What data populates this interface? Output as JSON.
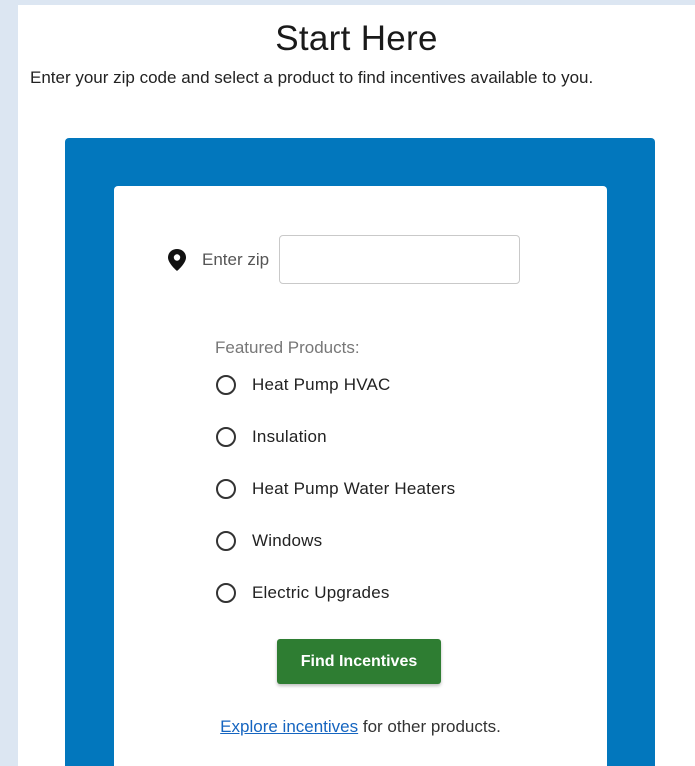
{
  "header": {
    "title": "Start Here",
    "subtitle": "Enter your zip code and select a product to find incentives available to you."
  },
  "zip": {
    "label": "Enter zip",
    "value": "",
    "icon": "map-pin-icon"
  },
  "products": {
    "label": "Featured Products:",
    "items": [
      {
        "label": "Heat Pump HVAC",
        "selected": false
      },
      {
        "label": "Insulation",
        "selected": false
      },
      {
        "label": "Heat Pump Water Heaters",
        "selected": false
      },
      {
        "label": "Windows",
        "selected": false
      },
      {
        "label": "Electric Upgrades",
        "selected": false
      }
    ]
  },
  "actions": {
    "find_label": "Find Incentives"
  },
  "footer": {
    "link_text": "Explore incentives",
    "suffix_text": " for other products."
  },
  "colors": {
    "panel_blue": "#0277bd",
    "button_green": "#2e7d32",
    "link_blue": "#1565c0"
  }
}
